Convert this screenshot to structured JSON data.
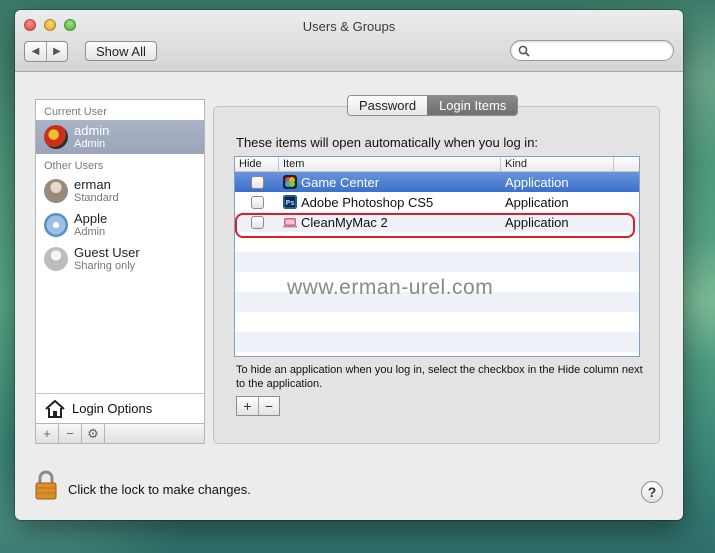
{
  "window": {
    "title": "Users & Groups"
  },
  "toolbar": {
    "back": "◀",
    "forward": "▶",
    "show_all": "Show All",
    "search_placeholder": ""
  },
  "sidebar": {
    "current_user_heading": "Current User",
    "current_user": {
      "name": "admin",
      "role": "Admin"
    },
    "other_users_heading": "Other Users",
    "other_users": [
      {
        "name": "erman",
        "role": "Standard"
      },
      {
        "name": "Apple",
        "role": "Admin"
      },
      {
        "name": "Guest User",
        "role": "Sharing only"
      }
    ],
    "login_options": "Login Options",
    "add": "+",
    "remove": "−",
    "gear": "⚙"
  },
  "tabs": {
    "password": "Password",
    "login_items": "Login Items",
    "active": "Login Items"
  },
  "login_items": {
    "intro": "These items will open automatically when you log in:",
    "columns": {
      "hide": "Hide",
      "item": "Item",
      "kind": "Kind"
    },
    "rows": [
      {
        "name": "Game Center",
        "kind": "Application",
        "hidden": false,
        "selected": true
      },
      {
        "name": "Adobe Photoshop CS5",
        "kind": "Application",
        "hidden": false,
        "selected": false
      },
      {
        "name": "CleanMyMac 2",
        "kind": "Application",
        "hidden": false,
        "selected": false
      }
    ],
    "hint": "To hide an application when you log in, select the checkbox in the Hide column next to the application.",
    "add": "+",
    "remove": "−"
  },
  "watermark": "www.erman-urel.com",
  "footer": {
    "lock_text": "Click the lock to make changes.",
    "help": "?"
  },
  "colors": {
    "selection": "#3a6fcd",
    "highlight_ring": "#d3222a"
  }
}
